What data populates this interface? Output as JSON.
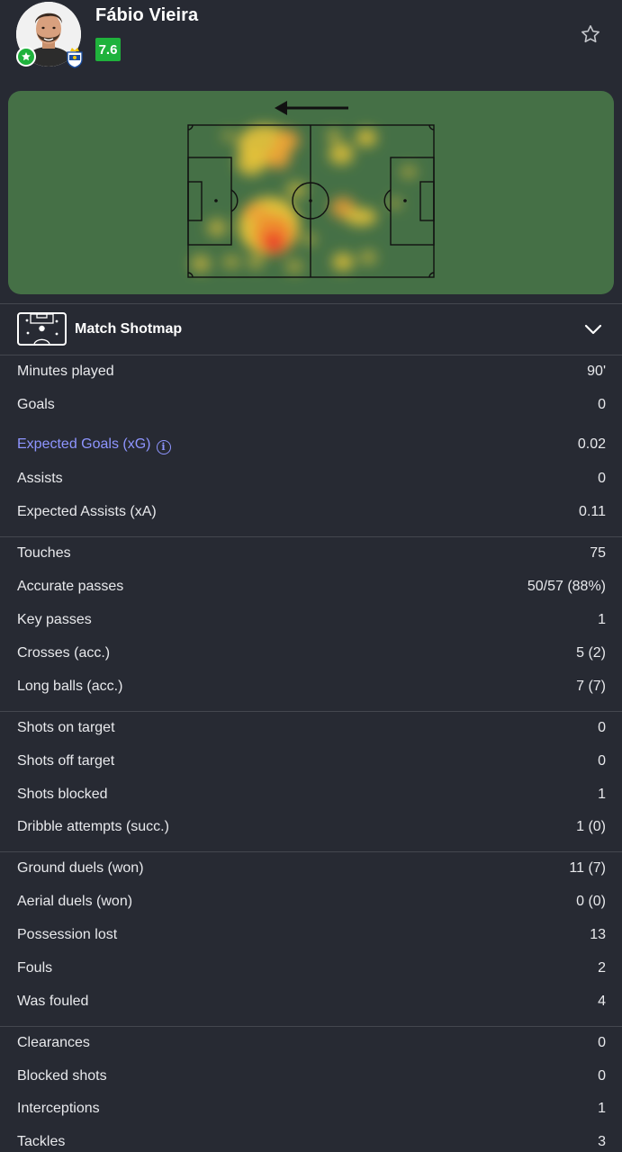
{
  "player": {
    "name": "Fábio Vieira",
    "rating": "7.6",
    "rating_color": "#1fb23c"
  },
  "icons": {
    "favorite": "star-outline-icon",
    "badge": "star-badge-icon",
    "club": "fc-porto-crest-icon",
    "expand": "chevron-down-icon",
    "info": "info-icon"
  },
  "heatmap": {
    "attack_direction": "left",
    "pitch_color": "#457046"
  },
  "shotmap": {
    "label": "Match Shotmap"
  },
  "groups": [
    [
      {
        "label": "Minutes played",
        "value": "90'"
      },
      {
        "label": "Goals",
        "value": "0"
      },
      {
        "label": "Expected Goals (xG)",
        "value": "0.02",
        "link": true
      },
      {
        "label": "Assists",
        "value": "0"
      },
      {
        "label": "Expected Assists (xA)",
        "value": "0.11"
      }
    ],
    [
      {
        "label": "Touches",
        "value": "75"
      },
      {
        "label": "Accurate passes",
        "value": "50/57 (88%)"
      },
      {
        "label": "Key passes",
        "value": "1"
      },
      {
        "label": "Crosses (acc.)",
        "value": "5 (2)"
      },
      {
        "label": "Long balls (acc.)",
        "value": "7 (7)"
      }
    ],
    [
      {
        "label": "Shots on target",
        "value": "0"
      },
      {
        "label": "Shots off target",
        "value": "0"
      },
      {
        "label": "Shots blocked",
        "value": "1"
      },
      {
        "label": "Dribble attempts (succ.)",
        "value": "1 (0)"
      }
    ],
    [
      {
        "label": "Ground duels (won)",
        "value": "11 (7)"
      },
      {
        "label": "Aerial duels (won)",
        "value": "0 (0)"
      },
      {
        "label": "Possession lost",
        "value": "13"
      },
      {
        "label": "Fouls",
        "value": "2"
      },
      {
        "label": "Was fouled",
        "value": "4"
      }
    ],
    [
      {
        "label": "Clearances",
        "value": "0"
      },
      {
        "label": "Blocked shots",
        "value": "0"
      },
      {
        "label": "Interceptions",
        "value": "1"
      },
      {
        "label": "Tackles",
        "value": "3"
      }
    ]
  ]
}
